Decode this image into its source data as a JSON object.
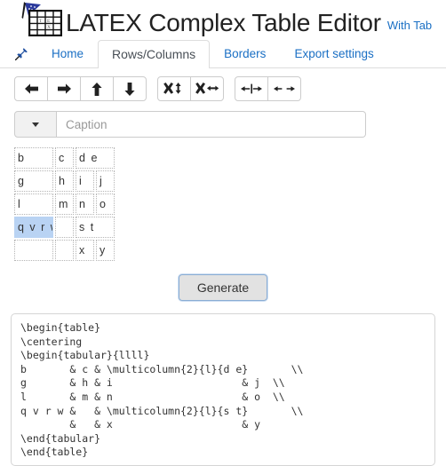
{
  "header": {
    "logo_icon": "latex-table-logo-icon",
    "title_parts": {
      "la": "L",
      "a_small": "A",
      "t": "T",
      "e": "E",
      "x": "X",
      "rest": " Complex Table Editor"
    },
    "title_full": "LATEX Complex Table Editor",
    "subtitle": "With Tab"
  },
  "nav": {
    "pin_icon": "pushpin-icon",
    "items": [
      {
        "label": "Home",
        "active": false
      },
      {
        "label": "Rows/Columns",
        "active": true
      },
      {
        "label": "Borders",
        "active": false
      },
      {
        "label": "Export settings",
        "active": false
      }
    ]
  },
  "toolbar": {
    "groups": [
      {
        "name": "move-group",
        "buttons": [
          {
            "name": "move-left-button",
            "icon": "arrow-left-icon",
            "title": "Move left"
          },
          {
            "name": "move-right-button",
            "icon": "arrow-right-icon",
            "title": "Move right"
          },
          {
            "name": "move-up-button",
            "icon": "arrow-up-icon",
            "title": "Move up"
          },
          {
            "name": "move-down-button",
            "icon": "arrow-down-icon",
            "title": "Move down"
          }
        ]
      },
      {
        "name": "delete-group",
        "buttons": [
          {
            "name": "delete-row-button",
            "icon": "x-vertical-arrow-icon",
            "title": "Delete row"
          },
          {
            "name": "delete-column-button",
            "icon": "x-horizontal-arrow-icon",
            "title": "Delete column"
          }
        ]
      },
      {
        "name": "merge-split-group",
        "buttons": [
          {
            "name": "merge-cells-button",
            "icon": "arrows-inward-icon",
            "title": "Merge cells"
          },
          {
            "name": "split-cells-button",
            "icon": "arrows-outward-icon",
            "title": "Split cells"
          }
        ]
      }
    ]
  },
  "caption": {
    "dropdown_icon": "caret-down-icon",
    "placeholder": "Caption",
    "value": ""
  },
  "grid": {
    "rows": [
      [
        {
          "text": "b",
          "colspan": 2,
          "selected": false
        },
        {
          "text": "c",
          "colspan": 1,
          "selected": false
        },
        {
          "text": "d e",
          "colspan": 2,
          "selected": false
        }
      ],
      [
        {
          "text": "g",
          "colspan": 2,
          "selected": false
        },
        {
          "text": "h",
          "colspan": 1,
          "selected": false
        },
        {
          "text": "i",
          "colspan": 1,
          "selected": false
        },
        {
          "text": "j",
          "colspan": 1,
          "selected": false
        }
      ],
      [
        {
          "text": "l",
          "colspan": 2,
          "selected": false
        },
        {
          "text": "m",
          "colspan": 1,
          "selected": false
        },
        {
          "text": "n",
          "colspan": 1,
          "selected": false
        },
        {
          "text": "o",
          "colspan": 1,
          "selected": false
        }
      ],
      [
        {
          "text": "q v r w",
          "colspan": 2,
          "selected": true
        },
        {
          "text": "",
          "colspan": 1,
          "selected": false
        },
        {
          "text": "s t",
          "colspan": 2,
          "selected": false
        }
      ],
      [
        {
          "text": "",
          "colspan": 2,
          "selected": false
        },
        {
          "text": "",
          "colspan": 1,
          "selected": false
        },
        {
          "text": "x",
          "colspan": 1,
          "selected": false
        },
        {
          "text": "y",
          "colspan": 1,
          "selected": false
        }
      ]
    ],
    "selection_color": "#b9d3f3"
  },
  "generate": {
    "label": "Generate"
  },
  "code": {
    "text": "\\begin{table}\n\\centering\n\\begin{tabular}{llll}\nb       & c & \\multicolumn{2}{l}{d e}       \\\\\ng       & h & i                     & j  \\\\\nl       & m & n                     & o  \\\\\nq v r w &   & \\multicolumn{2}{l}{s t}       \\\\\n        &   & x                     & y\n\\end{tabular}\n\\end{table}"
  },
  "colors": {
    "link": "#1a6fc4",
    "border": "#dddddd",
    "selection": "#b9d3f3"
  }
}
